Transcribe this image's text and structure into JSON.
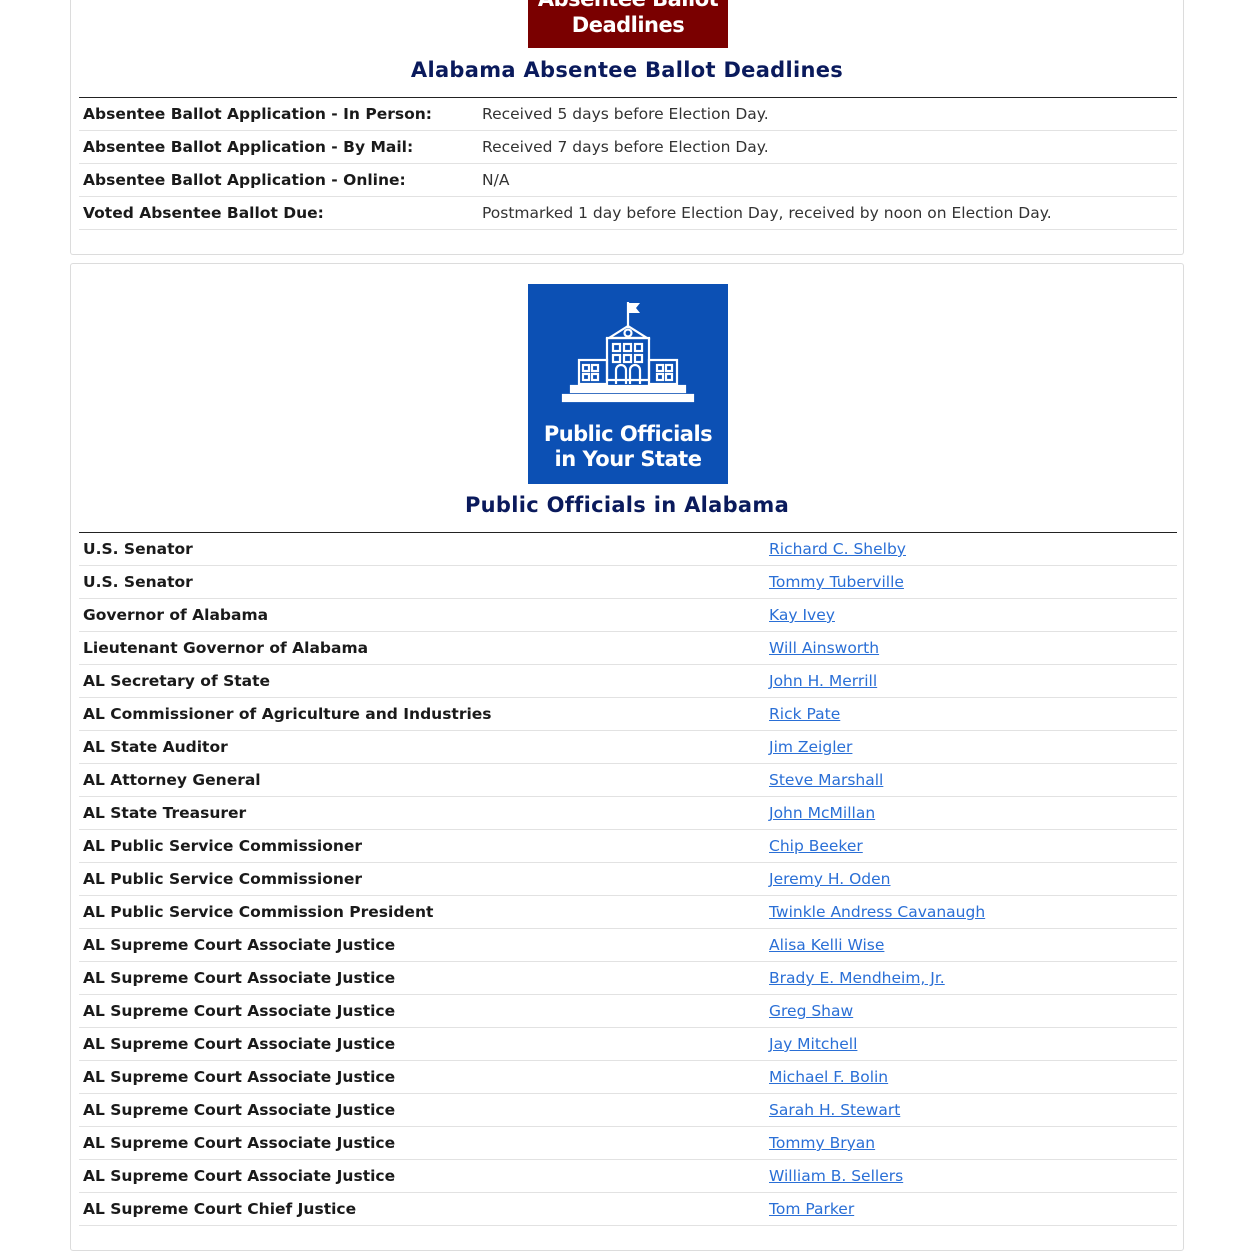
{
  "deadlines": {
    "banner_line1": "Absentee Ballot",
    "banner_line2": "Deadlines",
    "title": "Alabama Absentee Ballot Deadlines",
    "rows": [
      {
        "label": "Absentee Ballot Application - In Person:",
        "value": "Received 5 days before Election Day."
      },
      {
        "label": "Absentee Ballot Application - By Mail:",
        "value": "Received 7 days before Election Day."
      },
      {
        "label": "Absentee Ballot Application - Online:",
        "value": "N/A"
      },
      {
        "label": "Voted Absentee Ballot Due:",
        "value": "Postmarked 1 day before Election Day, received by noon on Election Day."
      }
    ]
  },
  "officials": {
    "banner_line1": "Public Officials",
    "banner_line2": "in Your State",
    "banner_icon": "government-building-icon",
    "title": "Public Officials in Alabama",
    "rows": [
      {
        "office": "U.S. Senator",
        "name": "Richard C. Shelby"
      },
      {
        "office": "U.S. Senator",
        "name": "Tommy Tuberville"
      },
      {
        "office": "Governor of Alabama",
        "name": "Kay Ivey"
      },
      {
        "office": "Lieutenant Governor of Alabama",
        "name": "Will Ainsworth"
      },
      {
        "office": "AL Secretary of State",
        "name": "John H. Merrill"
      },
      {
        "office": "AL Commissioner of Agriculture and Industries",
        "name": "Rick Pate"
      },
      {
        "office": "AL State Auditor",
        "name": "Jim Zeigler"
      },
      {
        "office": "AL Attorney General",
        "name": "Steve Marshall"
      },
      {
        "office": "AL State Treasurer",
        "name": "John McMillan"
      },
      {
        "office": "AL Public Service Commissioner",
        "name": "Chip Beeker"
      },
      {
        "office": "AL Public Service Commissioner",
        "name": "Jeremy H. Oden"
      },
      {
        "office": "AL Public Service Commission President",
        "name": "Twinkle Andress Cavanaugh"
      },
      {
        "office": "AL Supreme Court Associate Justice",
        "name": "Alisa Kelli Wise"
      },
      {
        "office": "AL Supreme Court Associate Justice",
        "name": "Brady E. Mendheim, Jr."
      },
      {
        "office": "AL Supreme Court Associate Justice",
        "name": "Greg Shaw"
      },
      {
        "office": "AL Supreme Court Associate Justice",
        "name": "Jay Mitchell"
      },
      {
        "office": "AL Supreme Court Associate Justice",
        "name": "Michael F. Bolin"
      },
      {
        "office": "AL Supreme Court Associate Justice",
        "name": "Sarah H. Stewart"
      },
      {
        "office": "AL Supreme Court Associate Justice",
        "name": "Tommy Bryan"
      },
      {
        "office": "AL Supreme Court Associate Justice",
        "name": "William B. Sellers"
      },
      {
        "office": "AL Supreme Court Chief Justice",
        "name": "Tom Parker"
      }
    ]
  },
  "colors": {
    "deadlines_banner": "#7a0000",
    "officials_banner": "#0c50b4",
    "title": "#0a1a5c",
    "link": "#2a6fd6"
  }
}
